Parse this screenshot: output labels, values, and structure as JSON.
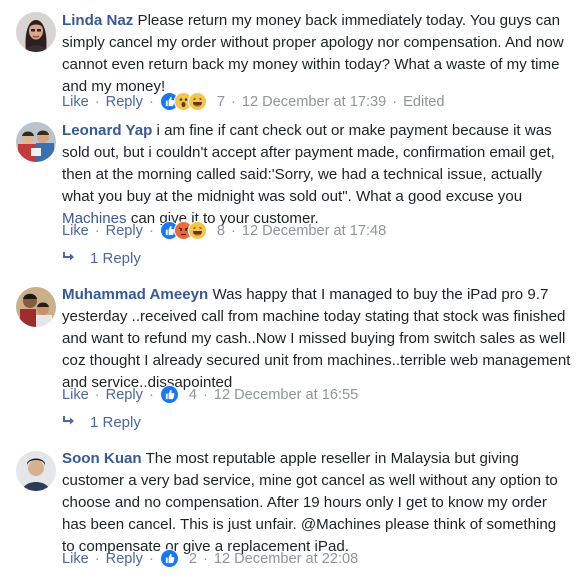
{
  "comments": [
    {
      "author": "Linda Naz",
      "text": "Please return my money back immediately today. You guys can simply cancel my order without proper apology nor compensation. And now cannot even return back my money within today? What a waste of my time and my money!",
      "like": "Like",
      "reply": "Reply",
      "reaction_count": "7",
      "timestamp": "12 December at 17:39",
      "edited": "Edited",
      "reactions": [
        "like-icon",
        "wow-icon",
        "haha-icon"
      ]
    },
    {
      "author": "Leonard Yap",
      "text_before": "i am fine if cant check out or make payment because it was sold out, but i couldn't accept after payment made, confirmation email get, then at the morning called said:'Sorry, we had a technical issue, actually what you buy at the midnight was sold out\". What a good excuse you",
      "text_link": "Machines",
      "text_after": "can give it to your customer.",
      "like": "Like",
      "reply": "Reply",
      "reaction_count": "8",
      "timestamp": "12 December at 17:48",
      "replies_label": "1 Reply",
      "reactions": [
        "like-icon",
        "angry-icon",
        "haha-icon"
      ]
    },
    {
      "author": "Muhammad Ameeyn",
      "text": "Was happy that I managed to buy the iPad pro 9.7 yesterday ..received call from machine today stating that stock was finished and want to refund my cash..Now I missed buying from switch sales as well coz thought I already secured unit from machines..terrible web management and service..dissapointed",
      "like": "Like",
      "reply": "Reply",
      "reaction_count": "4",
      "timestamp": "12 December at 16:55",
      "replies_label": "1 Reply",
      "reactions": [
        "like-icon"
      ]
    },
    {
      "author": "Soon Kuan",
      "text": "The most reputable apple reseller in Malaysia but giving customer a very bad service, mine got cancel as well without any option to choose and no compensation. After 19 hours only I get to know my order has been cancel. This is just unfair. @Machines please think of something to compensate or give a replacement iPad.",
      "like": "Like",
      "reply": "Reply",
      "reaction_count": "2",
      "timestamp": "12 December at 22:08",
      "reactions": [
        "like-icon"
      ]
    }
  ],
  "colors": {
    "author": "#385898",
    "meta": "#90949c",
    "like": "#1877f2",
    "wow": "#f7c44b",
    "angry": "#e86c3a"
  }
}
